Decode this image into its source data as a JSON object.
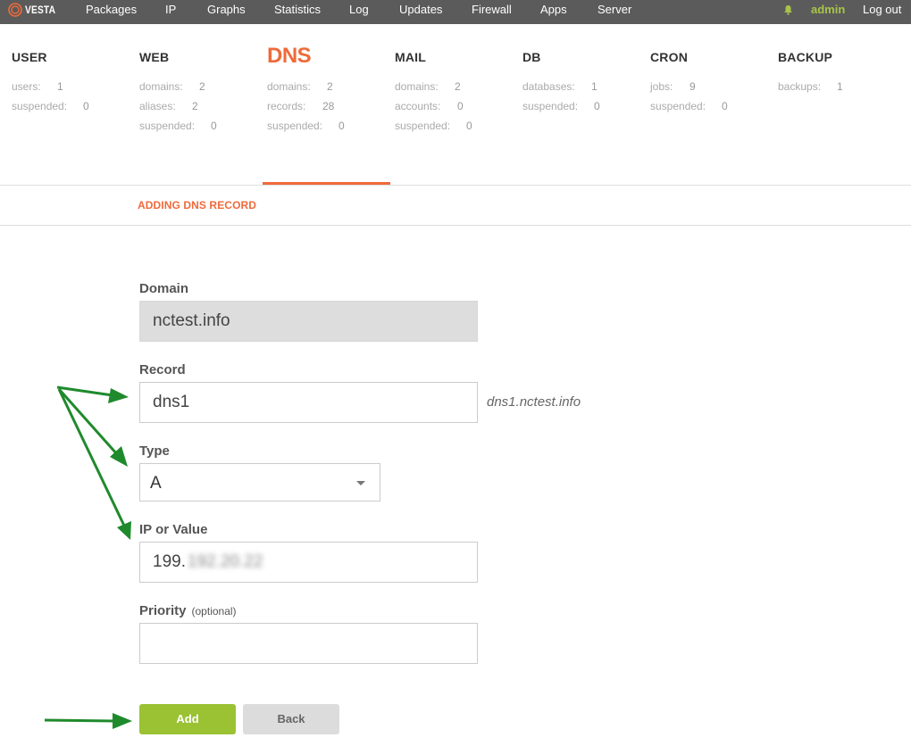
{
  "brand": {
    "name": "VESTA",
    "accent": "#ef6a3b",
    "nav_bg": "#5b5b5b",
    "user_color": "#a8c44a"
  },
  "nav": {
    "items": [
      "Packages",
      "IP",
      "Graphs",
      "Statistics",
      "Log",
      "Updates",
      "Firewall",
      "Apps",
      "Server"
    ],
    "user": "admin",
    "logout": "Log out"
  },
  "tabs": [
    {
      "title": "USER",
      "active": false,
      "stats": [
        {
          "label": "users:",
          "value": "1"
        },
        {
          "label": "suspended:",
          "value": "0"
        }
      ]
    },
    {
      "title": "WEB",
      "active": false,
      "stats": [
        {
          "label": "domains:",
          "value": "2"
        },
        {
          "label": "aliases:",
          "value": "2"
        },
        {
          "label": "suspended:",
          "value": "0"
        }
      ]
    },
    {
      "title": "DNS",
      "active": true,
      "stats": [
        {
          "label": "domains:",
          "value": "2"
        },
        {
          "label": "records:",
          "value": "28"
        },
        {
          "label": "suspended:",
          "value": "0"
        }
      ]
    },
    {
      "title": "MAIL",
      "active": false,
      "stats": [
        {
          "label": "domains:",
          "value": "2"
        },
        {
          "label": "accounts:",
          "value": "0"
        },
        {
          "label": "suspended:",
          "value": "0"
        }
      ]
    },
    {
      "title": "DB",
      "active": false,
      "stats": [
        {
          "label": "databases:",
          "value": "1"
        },
        {
          "label": "suspended:",
          "value": "0"
        }
      ]
    },
    {
      "title": "CRON",
      "active": false,
      "stats": [
        {
          "label": "jobs:",
          "value": "9"
        },
        {
          "label": "suspended:",
          "value": "0"
        }
      ]
    },
    {
      "title": "BACKUP",
      "active": false,
      "stats": [
        {
          "label": "backups:",
          "value": "1"
        }
      ]
    }
  ],
  "page": {
    "subheader": "ADDING DNS RECORD"
  },
  "form": {
    "domain": {
      "label": "Domain",
      "value": "nctest.info"
    },
    "record": {
      "label": "Record",
      "value": "dns1",
      "hint": "dns1.nctest.info"
    },
    "type": {
      "label": "Type",
      "value": "A"
    },
    "ip": {
      "label": "IP or Value",
      "value_prefix": "199.",
      "value_redacted": "192.20.22"
    },
    "priority": {
      "label": "Priority",
      "optional": "(optional)",
      "value": ""
    },
    "add_label": "Add",
    "back_label": "Back"
  }
}
